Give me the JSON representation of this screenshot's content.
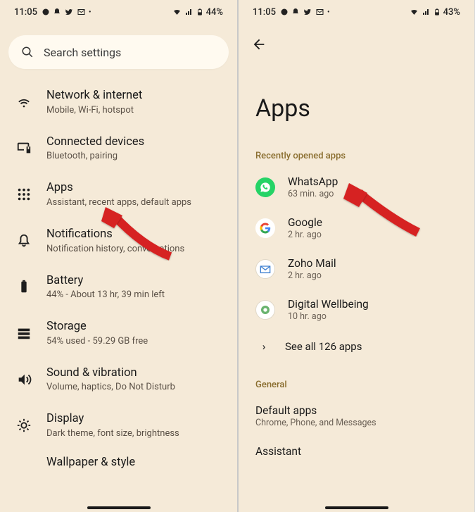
{
  "left": {
    "status": {
      "time": "11:05",
      "battery": "44%"
    },
    "search": {
      "placeholder": "Search settings"
    },
    "items": [
      {
        "title": "Network & internet",
        "sub": "Mobile, Wi-Fi, hotspot"
      },
      {
        "title": "Connected devices",
        "sub": "Bluetooth, pairing"
      },
      {
        "title": "Apps",
        "sub": "Assistant, recent apps, default apps"
      },
      {
        "title": "Notifications",
        "sub": "Notification history, conversations"
      },
      {
        "title": "Battery",
        "sub": "44% - About 13 hr, 39 min left"
      },
      {
        "title": "Storage",
        "sub": "54% used - 59.29 GB free"
      },
      {
        "title": "Sound & vibration",
        "sub": "Volume, haptics, Do Not Disturb"
      },
      {
        "title": "Display",
        "sub": "Dark theme, font size, brightness"
      },
      {
        "title": "Wallpaper & style",
        "sub": ""
      }
    ]
  },
  "right": {
    "status": {
      "time": "11:05",
      "battery": "43%"
    },
    "page_title": "Apps",
    "section_recent": "Recently opened apps",
    "apps": [
      {
        "name": "WhatsApp",
        "sub": "63 min. ago"
      },
      {
        "name": "Google",
        "sub": "2 hr. ago"
      },
      {
        "name": "Zoho Mail",
        "sub": "2 hr. ago"
      },
      {
        "name": "Digital Wellbeing",
        "sub": "10 hr. ago"
      }
    ],
    "see_all": "See all 126 apps",
    "section_general": "General",
    "general": [
      {
        "name": "Default apps",
        "sub": "Chrome, Phone, and Messages"
      },
      {
        "name": "Assistant",
        "sub": ""
      }
    ]
  }
}
